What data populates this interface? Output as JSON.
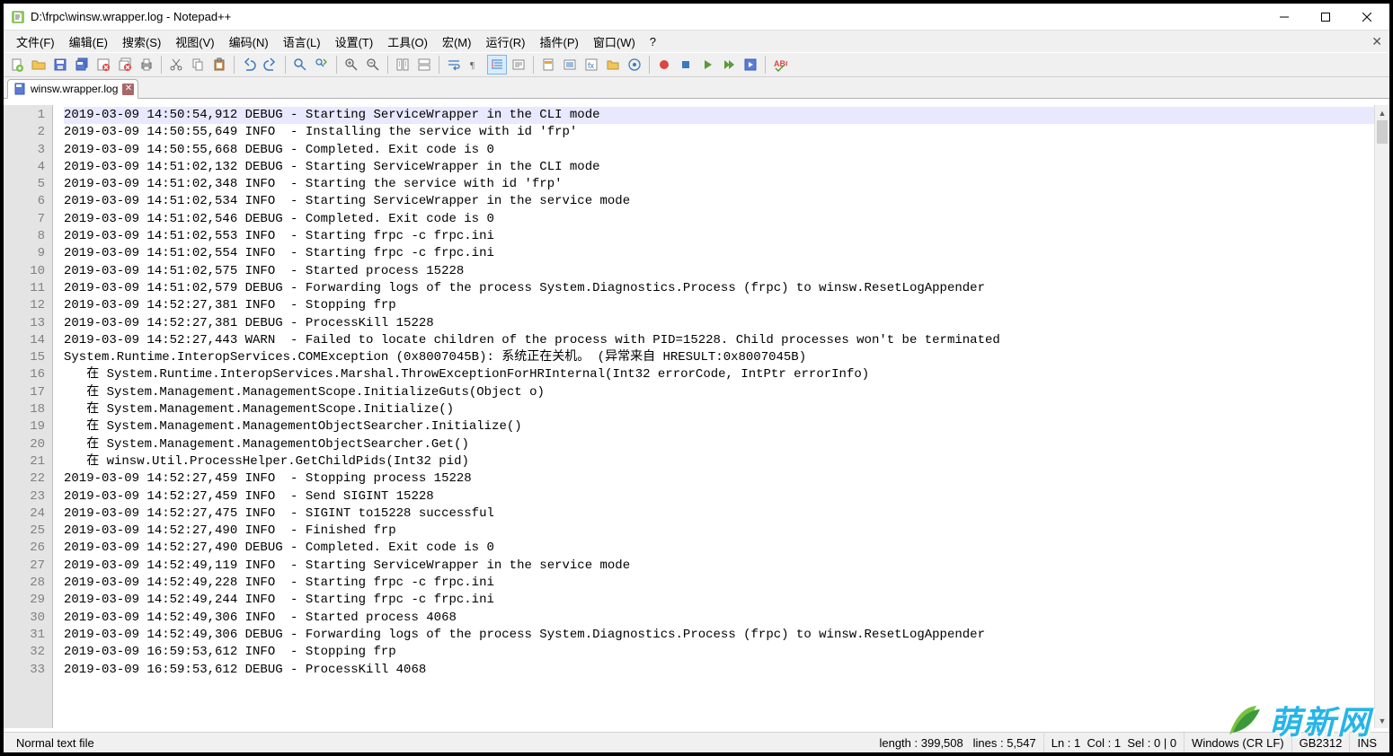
{
  "window": {
    "title": "D:\\frpc\\winsw.wrapper.log - Notepad++"
  },
  "menu": {
    "items": [
      "文件(F)",
      "编辑(E)",
      "搜索(S)",
      "视图(V)",
      "编码(N)",
      "语言(L)",
      "设置(T)",
      "工具(O)",
      "宏(M)",
      "运行(R)",
      "插件(P)",
      "窗口(W)",
      "?"
    ]
  },
  "tab": {
    "name": "winsw.wrapper.log"
  },
  "lines": [
    "2019-03-09 14:50:54,912 DEBUG - Starting ServiceWrapper in the CLI mode",
    "2019-03-09 14:50:55,649 INFO  - Installing the service with id 'frp'",
    "2019-03-09 14:50:55,668 DEBUG - Completed. Exit code is 0",
    "2019-03-09 14:51:02,132 DEBUG - Starting ServiceWrapper in the CLI mode",
    "2019-03-09 14:51:02,348 INFO  - Starting the service with id 'frp'",
    "2019-03-09 14:51:02,534 INFO  - Starting ServiceWrapper in the service mode",
    "2019-03-09 14:51:02,546 DEBUG - Completed. Exit code is 0",
    "2019-03-09 14:51:02,553 INFO  - Starting frpc -c frpc.ini",
    "2019-03-09 14:51:02,554 INFO  - Starting frpc -c frpc.ini",
    "2019-03-09 14:51:02,575 INFO  - Started process 15228",
    "2019-03-09 14:51:02,579 DEBUG - Forwarding logs of the process System.Diagnostics.Process (frpc) to winsw.ResetLogAppender",
    "2019-03-09 14:52:27,381 INFO  - Stopping frp",
    "2019-03-09 14:52:27,381 DEBUG - ProcessKill 15228",
    "2019-03-09 14:52:27,443 WARN  - Failed to locate children of the process with PID=15228. Child processes won't be terminated",
    "System.Runtime.InteropServices.COMException (0x8007045B): 系统正在关机。 (异常来自 HRESULT:0x8007045B)",
    "   在 System.Runtime.InteropServices.Marshal.ThrowExceptionForHRInternal(Int32 errorCode, IntPtr errorInfo)",
    "   在 System.Management.ManagementScope.InitializeGuts(Object o)",
    "   在 System.Management.ManagementScope.Initialize()",
    "   在 System.Management.ManagementObjectSearcher.Initialize()",
    "   在 System.Management.ManagementObjectSearcher.Get()",
    "   在 winsw.Util.ProcessHelper.GetChildPids(Int32 pid)",
    "2019-03-09 14:52:27,459 INFO  - Stopping process 15228",
    "2019-03-09 14:52:27,459 INFO  - Send SIGINT 15228",
    "2019-03-09 14:52:27,475 INFO  - SIGINT to15228 successful",
    "2019-03-09 14:52:27,490 INFO  - Finished frp",
    "2019-03-09 14:52:27,490 DEBUG - Completed. Exit code is 0",
    "2019-03-09 14:52:49,119 INFO  - Starting ServiceWrapper in the service mode",
    "2019-03-09 14:52:49,228 INFO  - Starting frpc -c frpc.ini",
    "2019-03-09 14:52:49,244 INFO  - Starting frpc -c frpc.ini",
    "2019-03-09 14:52:49,306 INFO  - Started process 4068",
    "2019-03-09 14:52:49,306 DEBUG - Forwarding logs of the process System.Diagnostics.Process (frpc) to winsw.ResetLogAppender",
    "2019-03-09 16:59:53,612 INFO  - Stopping frp",
    "2019-03-09 16:59:53,612 DEBUG - ProcessKill 4068"
  ],
  "status": {
    "filetype": "Normal text file",
    "length_label": "length :",
    "length_value": "399,508",
    "lines_label": "lines :",
    "lines_value": "5,547",
    "ln_label": "Ln :",
    "ln_value": "1",
    "col_label": "Col :",
    "col_value": "1",
    "sel_label": "Sel :",
    "sel_value": "0 | 0",
    "eol": "Windows (CR LF)",
    "encoding": "GB2312",
    "ins": "INS"
  },
  "watermark": {
    "text": "萌新网"
  }
}
